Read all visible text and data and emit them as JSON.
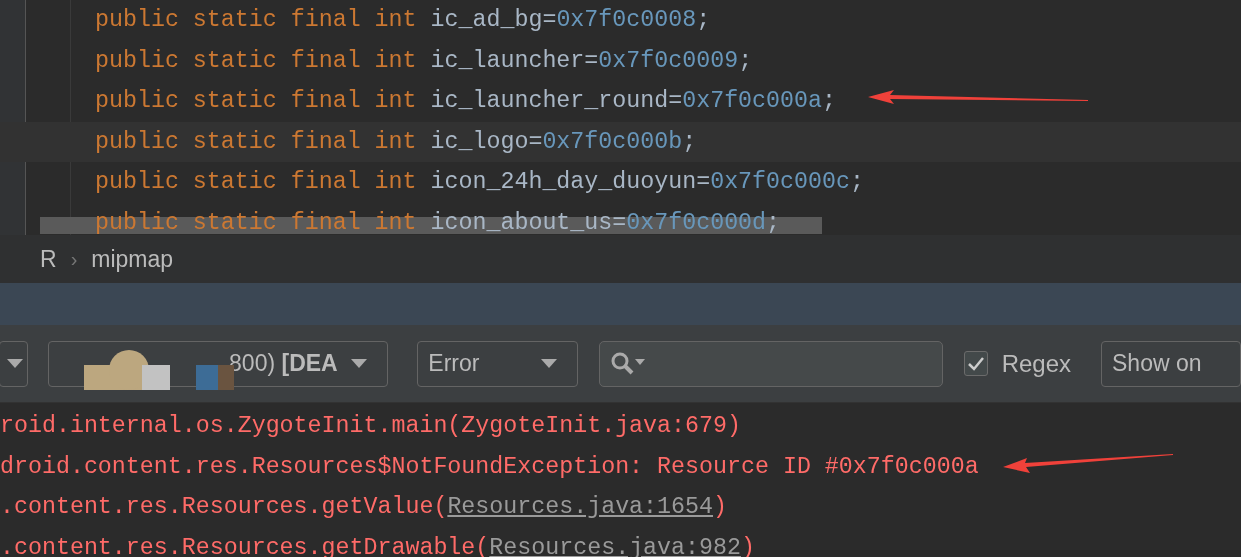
{
  "code_lines": [
    {
      "keywords": "public static final int",
      "identifier": "ic_ad_bg=",
      "value": "0x7f0c0008",
      "end": ";",
      "current": false
    },
    {
      "keywords": "public static final int",
      "identifier": "ic_launcher=",
      "value": "0x7f0c0009",
      "end": ";",
      "current": false
    },
    {
      "keywords": "public static final int",
      "identifier": "ic_launcher_round=",
      "value": "0x7f0c000a",
      "end": ";",
      "current": false
    },
    {
      "keywords": "public static final int",
      "identifier": "ic_logo=",
      "value": "0x7f0c000b",
      "end": ";",
      "current": true
    },
    {
      "keywords": "public static final int",
      "identifier": "icon_24h_day_duoyun=",
      "value": "0x7f0c000c",
      "end": ";",
      "current": false
    },
    {
      "keywords": "public static final int",
      "identifier": "icon_about_us=",
      "value": "0x7f0c000d",
      "end": ";",
      "current": false
    }
  ],
  "breadcrumb": [
    {
      "kind": "item",
      "text": "R"
    },
    {
      "kind": "separator",
      "text": "›"
    },
    {
      "kind": "item",
      "text": "mipmap"
    }
  ],
  "toolbar": {
    "device_dropdown": {
      "value": "800) **[DEA**"
    },
    "level_dropdown": {
      "value": "Error"
    },
    "regex": {
      "label": "Regex",
      "checked": true
    },
    "filter_dropdown": {
      "value": "Show on"
    }
  },
  "log_lines": [
    {
      "text": "roid.internal.os.ZygoteInit.main(ZygoteInit.java:679)"
    },
    {
      "text": "droid.content.res.Resources$NotFoundException: Resource ID #0x7f0c000a"
    },
    {
      "text": ".content.res.Resources.getValue(",
      "link": "Resources.java:1654",
      "after": ")"
    },
    {
      "text": ".content.res.Resources.getDrawable(",
      "link": "Resources.java:982",
      "after": ")"
    }
  ]
}
